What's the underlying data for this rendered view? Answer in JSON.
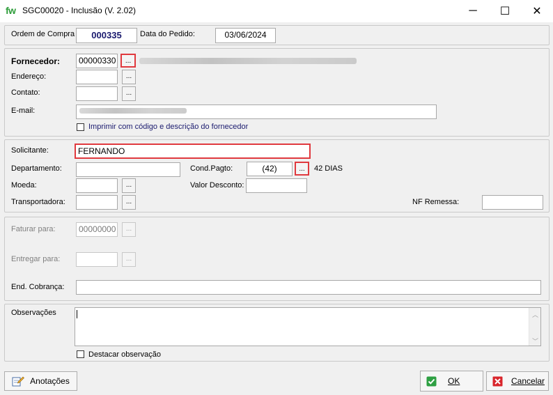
{
  "window": {
    "logo": "fw",
    "title": "SGC00020 - Inclusão  (V. 2.02)",
    "minimize_icon": "─",
    "maximize_icon": "☐",
    "close_icon": "✕"
  },
  "header": {
    "order_label": "Ordem de Compra",
    "order_value": "000335",
    "date_label": "Data do Pedido:",
    "date_value": "03/06/2024"
  },
  "supplier": {
    "label": "Fornecedor:",
    "code": "00000330",
    "address_label": "Endereço:",
    "contact_label": "Contato:",
    "email_label": "E-mail:",
    "print_label": "Imprimir com código e descrição do fornecedor"
  },
  "request": {
    "requester_label": "Solicitante:",
    "requester_value": "FERNANDO",
    "department_label": "Departamento:",
    "payment_label": "Cond.Pagto:",
    "payment_code": "(42)",
    "payment_desc": "42 DIAS",
    "currency_label": "Moeda:",
    "discount_label": "Valor Desconto:",
    "carrier_label": "Transportadora:",
    "nf_label": "NF Remessa:"
  },
  "billing": {
    "bill_to_label": "Faturar para:",
    "bill_to_value": "00000000",
    "deliver_label": "Entregar para:",
    "charge_label": "End. Cobrança:"
  },
  "notes": {
    "label": "Observações",
    "highlight_label": "Destacar observação"
  },
  "footer": {
    "notes_button": "Anotações",
    "ok_button": "OK",
    "cancel_button": "Cancelar"
  },
  "dots_label": "..."
}
